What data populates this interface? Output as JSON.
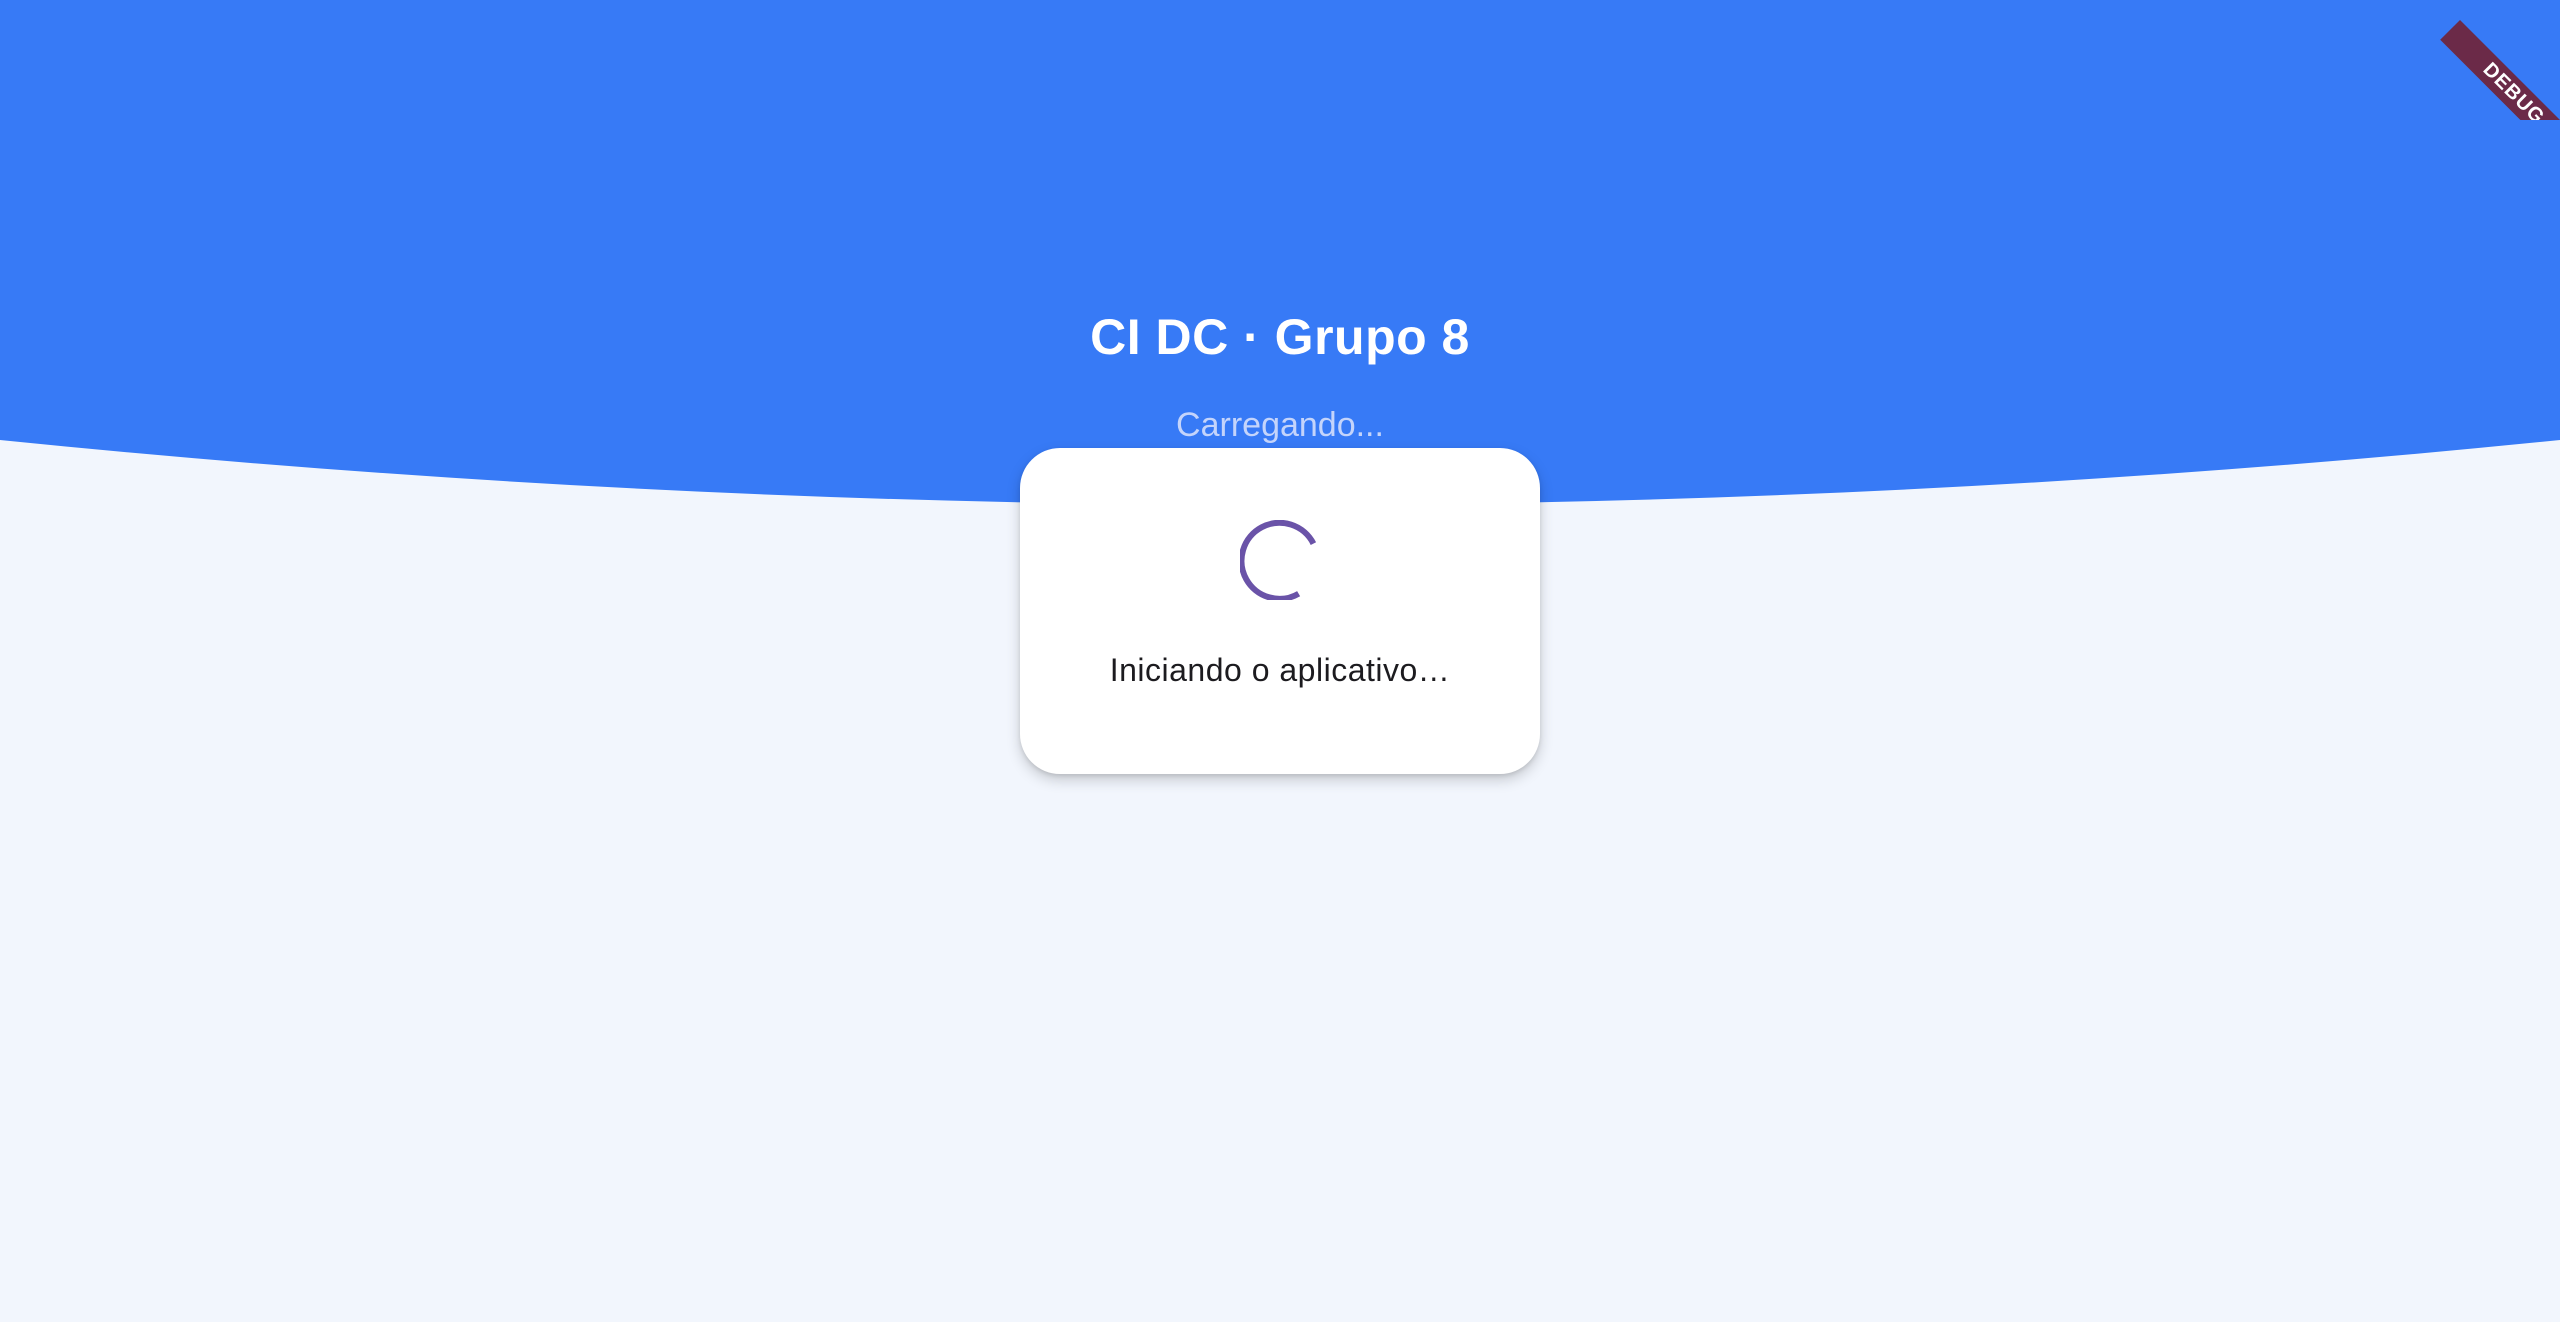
{
  "header": {
    "title": "CI DC · Grupo 8",
    "subtitle": "Carregando..."
  },
  "loading_card": {
    "message": "Iniciando o aplicativo…"
  },
  "debug_banner": {
    "label": "DEBUG"
  },
  "colors": {
    "header_blue": "#377af6",
    "background": "#f2f6fd",
    "spinner": "#6a53a8",
    "debug_banner": "#6b2a48"
  }
}
